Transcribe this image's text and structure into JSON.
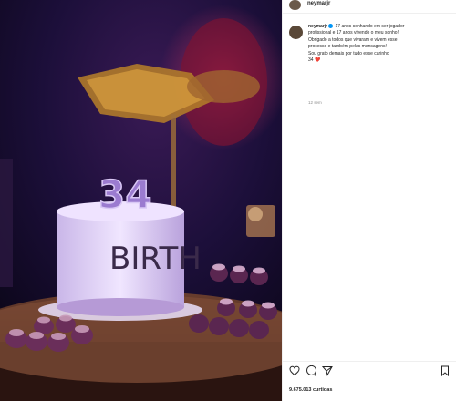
{
  "post": {
    "author_handle": "neymarjr",
    "caption_lines": [
      "17 anos sonhando em ser jogador",
      "profissional e 17 anos vivendo o meu sonho!",
      "Obrigado a todos que vivaram e vivem esse",
      "processo e também pelas mensagens!",
      "Sou grato demais por tudo esse carinho",
      "34 ❤️"
    ],
    "time_ago": "12 sem",
    "likes_text": "9.675.013 curtidas"
  },
  "photo": {
    "cake_number": "34",
    "cake_text": "BIRTH"
  },
  "colors": {
    "accent": "#0095f6",
    "text": "#262626",
    "muted": "#8e8e8e"
  },
  "icons": [
    "heart-icon",
    "comment-icon",
    "share-icon",
    "bookmark-icon",
    "verified-icon"
  ]
}
